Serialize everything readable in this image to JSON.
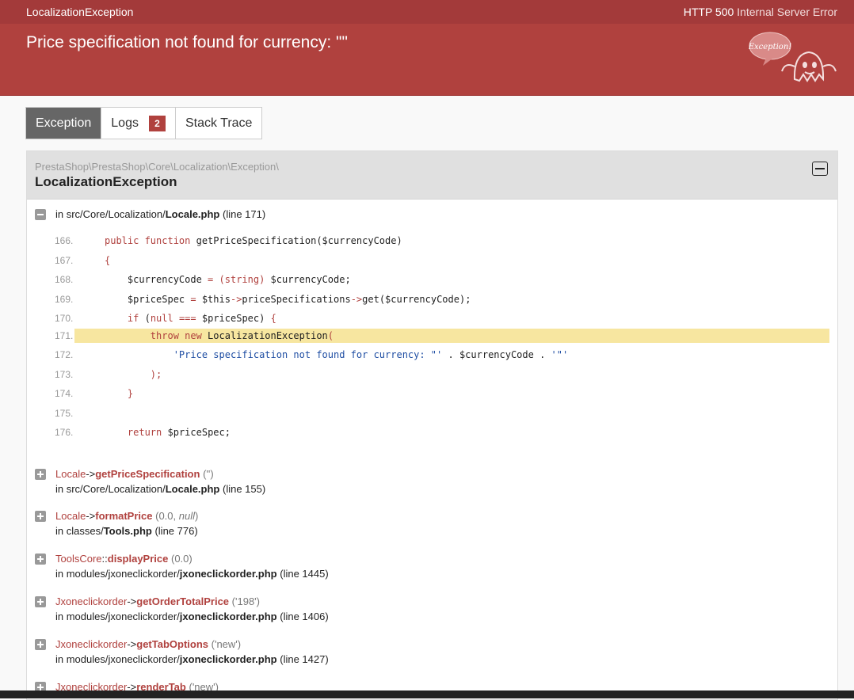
{
  "topbar": {
    "exception_class": "LocalizationException",
    "status_code": "HTTP 500",
    "status_text": "Internal Server Error"
  },
  "header": {
    "message": "Price specification not found for currency: \"\"",
    "bubble_text": "Exception!"
  },
  "tabs": [
    {
      "label": "Exception",
      "active": true
    },
    {
      "label": "Logs",
      "badge": "2"
    },
    {
      "label": "Stack Trace"
    }
  ],
  "panel": {
    "namespace": "PrestaShop\\PrestaShop\\Core\\Localization\\Exception\\",
    "class_name": "LocalizationException",
    "first_frame": {
      "prefix": "in src/Core/Localization/",
      "file": "Locale.php",
      "line": "(line 171)"
    },
    "code": [
      {
        "num": "166.",
        "text": "public function getPriceSpecification($currencyCode)"
      },
      {
        "num": "167.",
        "text": "{"
      },
      {
        "num": "168.",
        "text": "    $currencyCode = (string) $currencyCode;"
      },
      {
        "num": "169.",
        "text": "    $priceSpec = $this->priceSpecifications->get($currencyCode);"
      },
      {
        "num": "170.",
        "text": "    if (null === $priceSpec) {"
      },
      {
        "num": "171.",
        "text": "        throw new LocalizationException("
      },
      {
        "num": "172.",
        "text": "            'Price specification not found for currency: \"' . $currencyCode . '\"'"
      },
      {
        "num": "173.",
        "text": "        );"
      },
      {
        "num": "174.",
        "text": "    }"
      },
      {
        "num": "175.",
        "text": ""
      },
      {
        "num": "176.",
        "text": "    return $priceSpec;"
      }
    ],
    "frames": [
      {
        "cls": "Locale",
        "sep": "->",
        "fn": "getPriceSpecification",
        "args": "('')",
        "prefix": "in src/Core/Localization/",
        "file": "Locale.php",
        "line": "(line 155)"
      },
      {
        "cls": "Locale",
        "sep": "->",
        "fn": "formatPrice",
        "args_pre": "(0.0, ",
        "args_italic": "null",
        "args_post": ")",
        "prefix": "in classes/",
        "file": "Tools.php",
        "line": "(line 776)"
      },
      {
        "cls": "ToolsCore",
        "sep": "::",
        "fn": "displayPrice",
        "args": "(0.0)",
        "prefix": "in modules/jxoneclickorder/",
        "file": "jxoneclickorder.php",
        "line": "(line 1445)"
      },
      {
        "cls": "Jxoneclickorder",
        "sep": "->",
        "fn": "getOrderTotalPrice",
        "args": "('198')",
        "prefix": "in modules/jxoneclickorder/",
        "file": "jxoneclickorder.php",
        "line": "(line 1406)"
      },
      {
        "cls": "Jxoneclickorder",
        "sep": "->",
        "fn": "getTabOptions",
        "args": "('new')",
        "prefix": "in modules/jxoneclickorder/",
        "file": "jxoneclickorder.php",
        "line": "(line 1427)"
      },
      {
        "cls": "Jxoneclickorder",
        "sep": "->",
        "fn": "renderTab",
        "args": "('new')",
        "prefix": "",
        "file": "",
        "line": ""
      }
    ]
  }
}
